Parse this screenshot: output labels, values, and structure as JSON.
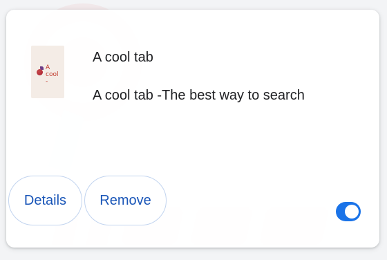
{
  "extension": {
    "icon": {
      "name": "extension-logo",
      "logo_text": "A\ncool\n-"
    },
    "name": "A cool tab",
    "description": "A cool tab -The best way to search"
  },
  "actions": {
    "details_label": "Details",
    "remove_label": "Remove"
  },
  "toggle": {
    "enabled": true
  },
  "colors": {
    "accent": "#1a73e8",
    "button_text": "#1a56b8",
    "button_border": "#c2d4ef",
    "card_bg": "#ffffff",
    "text": "#202124"
  }
}
